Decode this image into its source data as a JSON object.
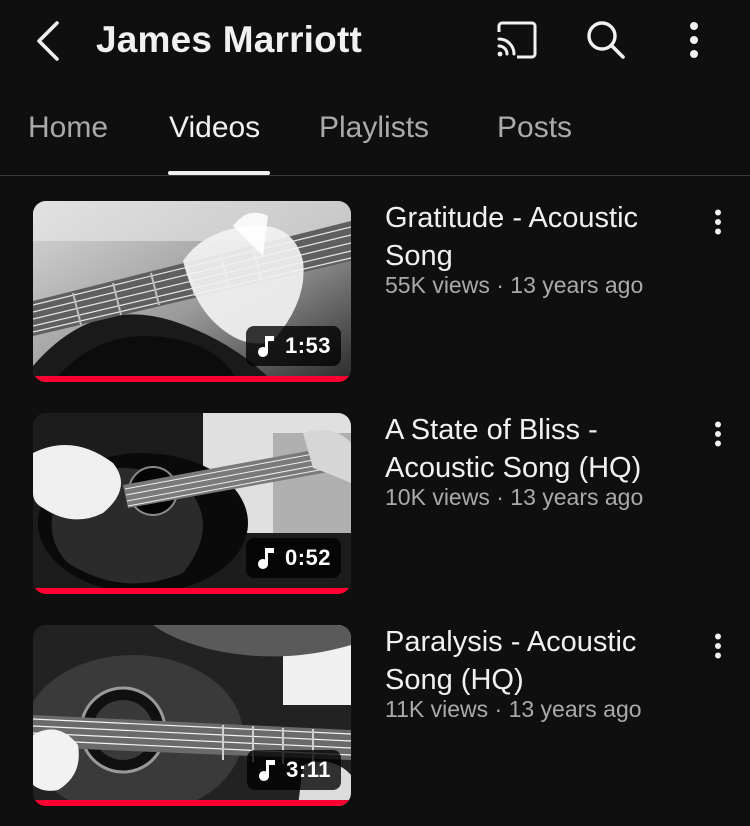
{
  "header": {
    "channel_name": "James Marriott",
    "back_icon": "chevron-left-icon",
    "cast_icon": "cast-icon",
    "search_icon": "search-icon",
    "more_icon": "more-vertical-icon"
  },
  "tabs": [
    {
      "label": "Home",
      "active": false
    },
    {
      "label": "Videos",
      "active": true
    },
    {
      "label": "Playlists",
      "active": false
    },
    {
      "label": "Posts",
      "active": false
    }
  ],
  "videos": [
    {
      "title": "Gratitude - Acoustic Song",
      "views": "55K views",
      "separator": "·",
      "age": "13 years ago",
      "duration": "1:53",
      "duration_icon": "music-note-icon",
      "watched_fraction": 1.0
    },
    {
      "title": "A State of Bliss - Acoustic Song (HQ)",
      "views": "10K views",
      "separator": "·",
      "age": "13 years ago",
      "duration": "0:52",
      "duration_icon": "music-note-icon",
      "watched_fraction": 1.0
    },
    {
      "title": "Paralysis - Acoustic Song (HQ)",
      "views": "11K views",
      "separator": "·",
      "age": "13 years ago",
      "duration": "3:11",
      "duration_icon": "music-note-icon",
      "watched_fraction": 1.0
    }
  ],
  "colors": {
    "background": "#0f0f0f",
    "text_primary": "#f1f1f1",
    "text_secondary": "#aaaaaa",
    "progress": "#ff0033"
  }
}
